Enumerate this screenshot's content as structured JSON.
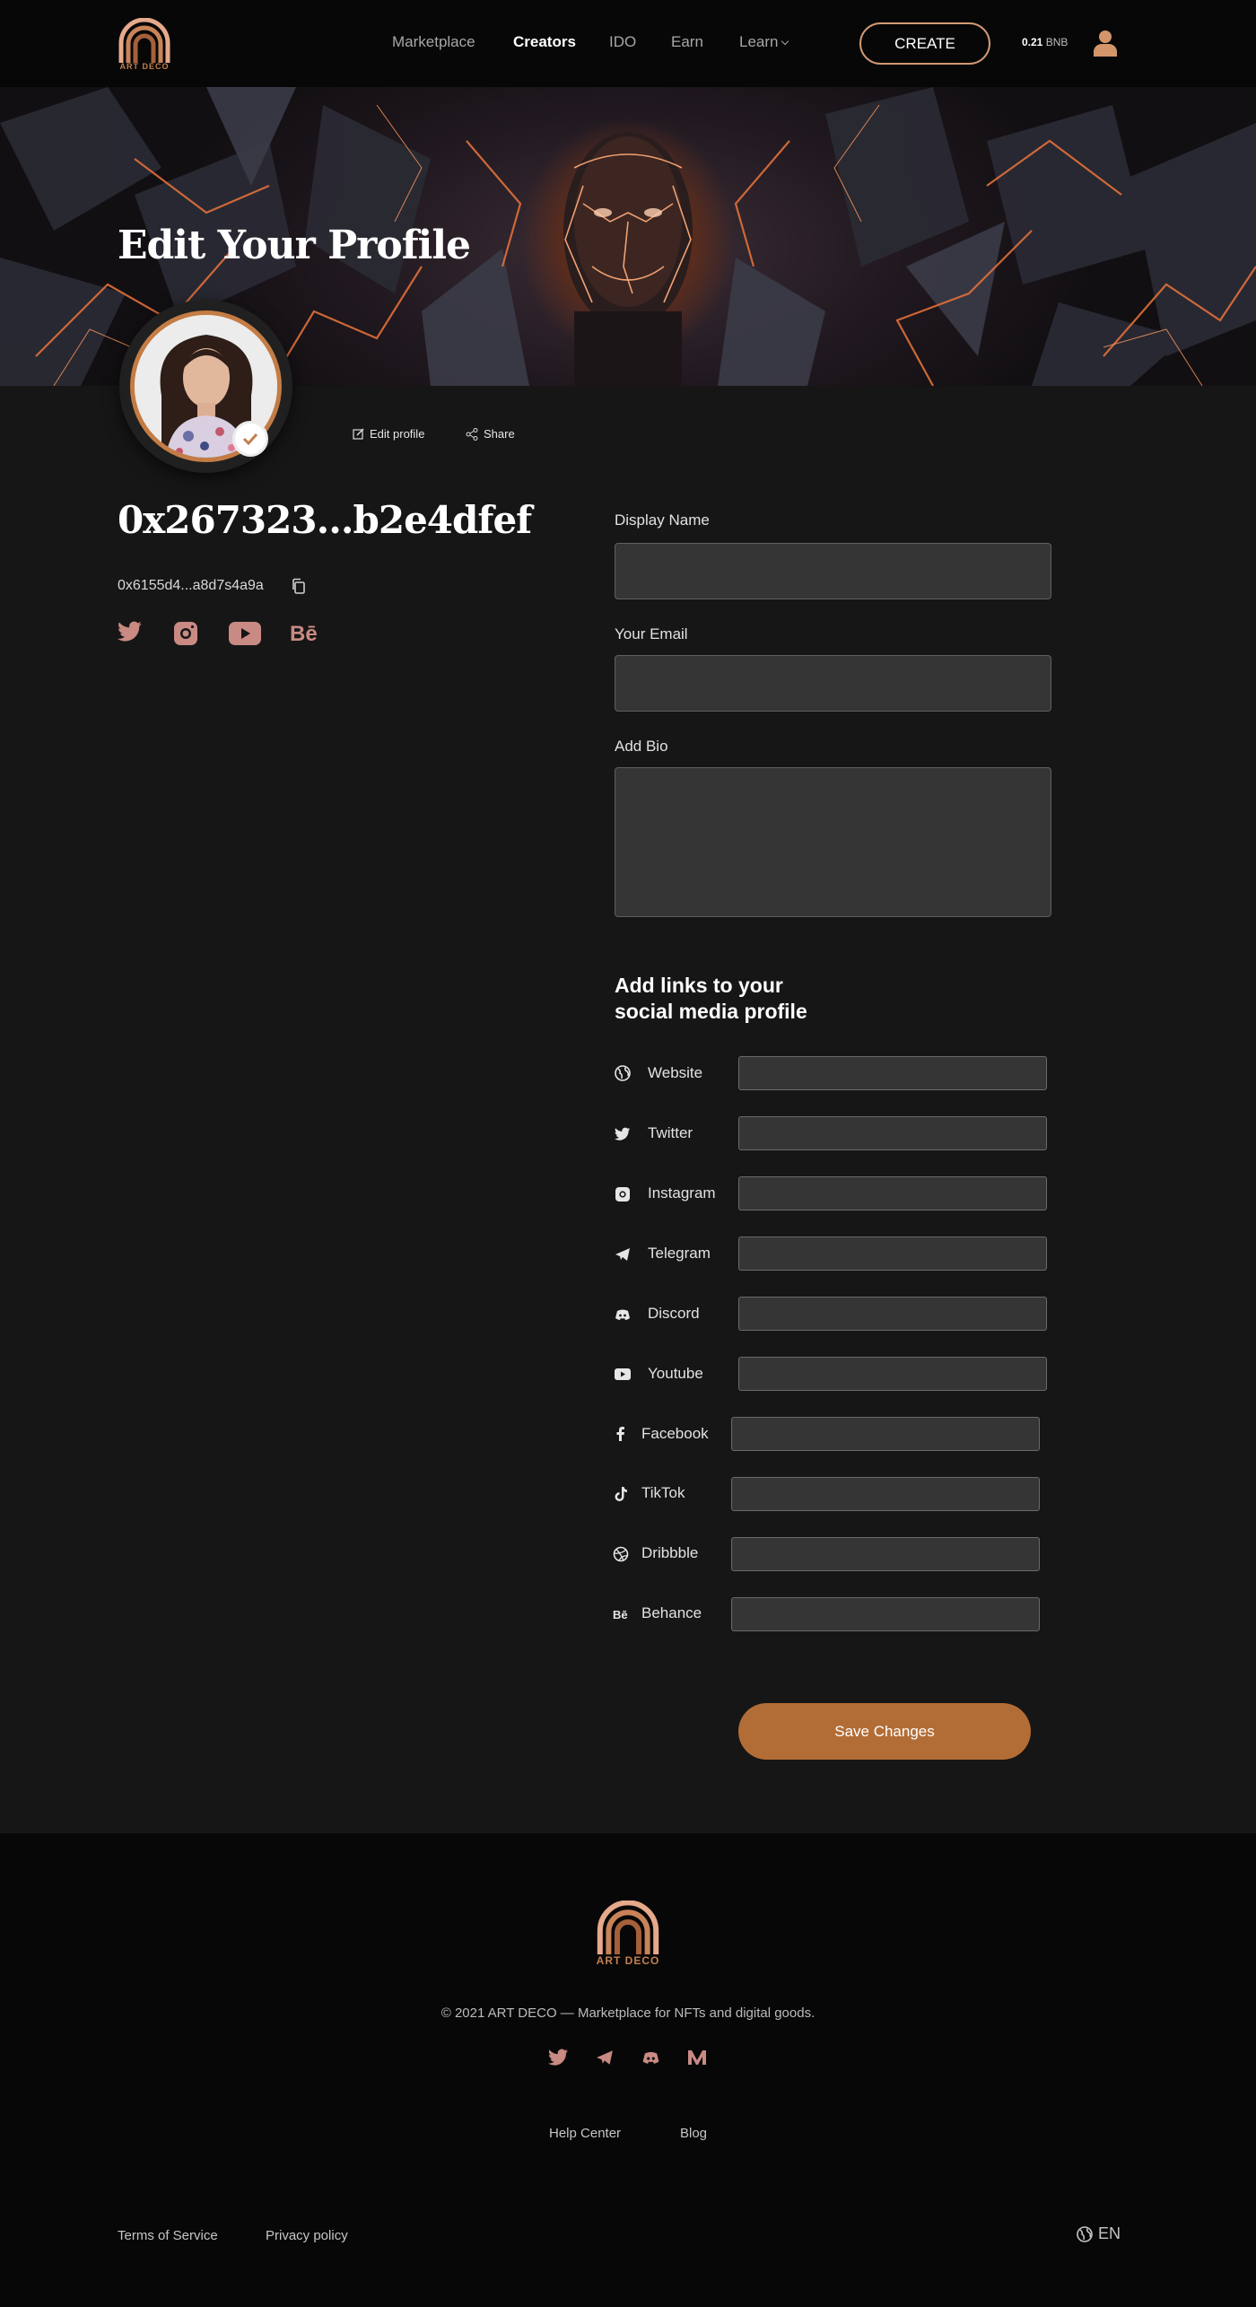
{
  "header": {
    "logo_text": "ART DECO",
    "nav": [
      {
        "label": "Marketplace"
      },
      {
        "label": "Creators"
      },
      {
        "label": "IDO"
      },
      {
        "label": "Earn"
      },
      {
        "label": "Learn"
      }
    ],
    "create_label": "CREATE",
    "balance_amount": "0.21",
    "balance_unit": "BNB"
  },
  "banner": {
    "title": "Edit Your Profile"
  },
  "profile": {
    "edit_label": "Edit profile",
    "share_label": "Share",
    "address_title": "0x267323...b2e4dfef",
    "short_address": "0x6155d4...a8d7s4a9a",
    "socials": [
      "twitter-icon",
      "instagram-icon",
      "youtube-icon",
      "behance-icon"
    ]
  },
  "form": {
    "display_name_label": "Display Name",
    "display_name_value": "",
    "email_label": "Your Email",
    "email_value": "",
    "bio_label": "Add Bio",
    "bio_value": "",
    "links_title_line1": "Add links to your",
    "links_title_line2": "social media profile",
    "links": [
      {
        "label": "Website",
        "icon": "globe-icon"
      },
      {
        "label": "Twitter",
        "icon": "twitter-icon"
      },
      {
        "label": "Instagram",
        "icon": "instagram-icon"
      },
      {
        "label": "Telegram",
        "icon": "telegram-icon"
      },
      {
        "label": "Discord",
        "icon": "discord-icon"
      },
      {
        "label": "Youtube",
        "icon": "youtube-icon"
      },
      {
        "label": "Facebook",
        "icon": "facebook-icon"
      },
      {
        "label": "TikTok",
        "icon": "tiktok-icon"
      },
      {
        "label": "Dribbble",
        "icon": "dribbble-icon"
      },
      {
        "label": "Behance",
        "icon": "behance-icon"
      }
    ],
    "save_label": "Save Changes"
  },
  "footer": {
    "logo_text": "ART DECO",
    "copyright": "© 2021 ART DECO — Marketplace for NFTs and digital goods.",
    "socials": [
      "twitter-icon",
      "telegram-icon",
      "discord-icon",
      "medium-icon"
    ],
    "help_center": "Help Center",
    "blog": "Blog",
    "terms": "Terms of Service",
    "privacy": "Privacy policy",
    "language": "EN"
  },
  "colors": {
    "accent": "#b26d36",
    "accent_light": "#d29a73",
    "icon_pink": "#c98a84",
    "background": "#161616",
    "header_bg": "#070707"
  }
}
